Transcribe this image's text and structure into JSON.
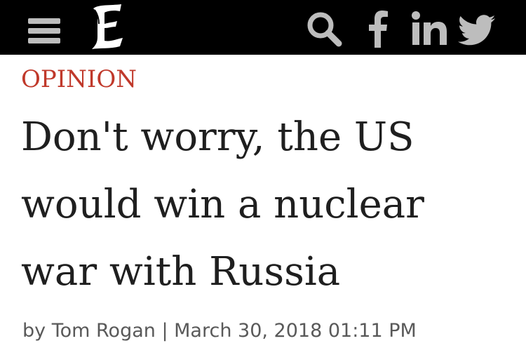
{
  "header": {
    "menu_icon": "hamburger-menu-icon",
    "logo_icon": "blackletter-e-logo",
    "social_icons": [
      "search-icon",
      "facebook-icon",
      "linkedin-icon",
      "twitter-icon"
    ]
  },
  "article": {
    "section": "OPINION",
    "headline": "Don't worry, the US would win a nuclear war with Russia",
    "byline": "by Tom Rogan | March 30, 2018 01:11 PM"
  },
  "colors": {
    "header_bg": "#000000",
    "icon_gray": "#bdbdbd",
    "section_red": "#c0392b",
    "headline_text": "#1f1f1f",
    "byline_text": "#595959"
  }
}
